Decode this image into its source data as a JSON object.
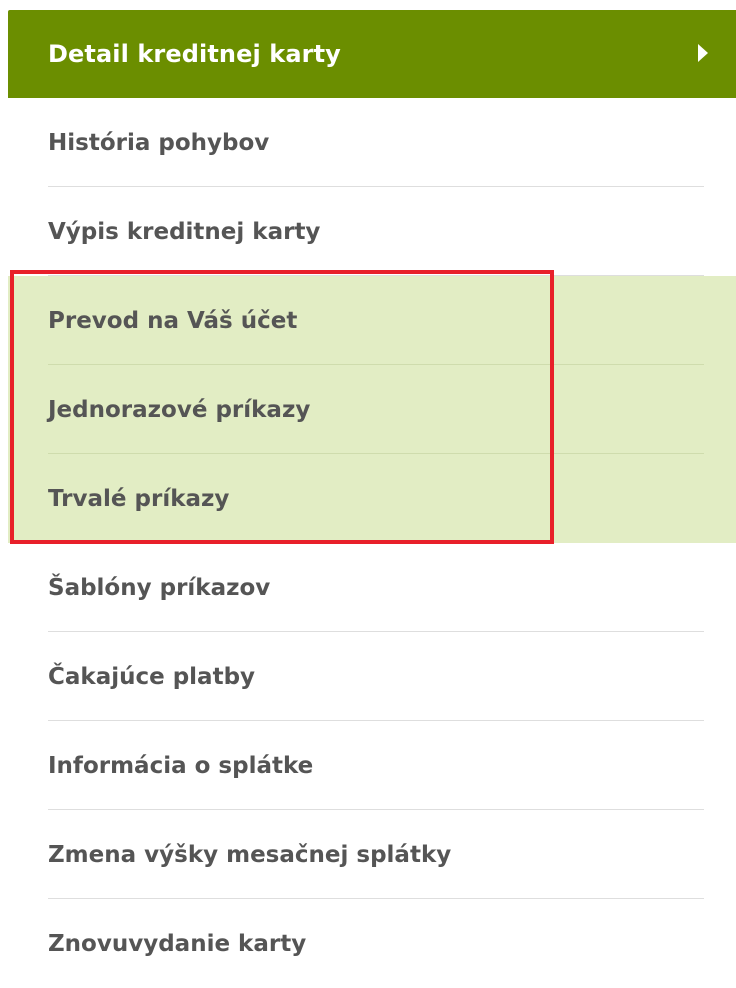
{
  "menu": {
    "header": {
      "label": "Detail kreditnej karty",
      "icon": "triangle-right-icon"
    },
    "items": [
      {
        "label": "História pohybov",
        "highlighted": false
      },
      {
        "label": "Výpis kreditnej karty",
        "highlighted": false
      },
      {
        "label": "Prevod na Váš účet",
        "highlighted": true
      },
      {
        "label": "Jednorazové príkazy",
        "highlighted": true
      },
      {
        "label": "Trvalé príkazy",
        "highlighted": true
      },
      {
        "label": "Šablóny príkazov",
        "highlighted": false
      },
      {
        "label": "Čakajúce platby",
        "highlighted": false
      },
      {
        "label": "Informácia o splátke",
        "highlighted": false
      },
      {
        "label": "Zmena výšky mesačnej splátky",
        "highlighted": false
      },
      {
        "label": "Znovuvydanie karty",
        "highlighted": false
      }
    ]
  },
  "colors": {
    "header_bg": "#6b8e00",
    "highlight_bg": "#e2edc4",
    "annotation_border": "#e8202a",
    "item_text": "#555555"
  }
}
